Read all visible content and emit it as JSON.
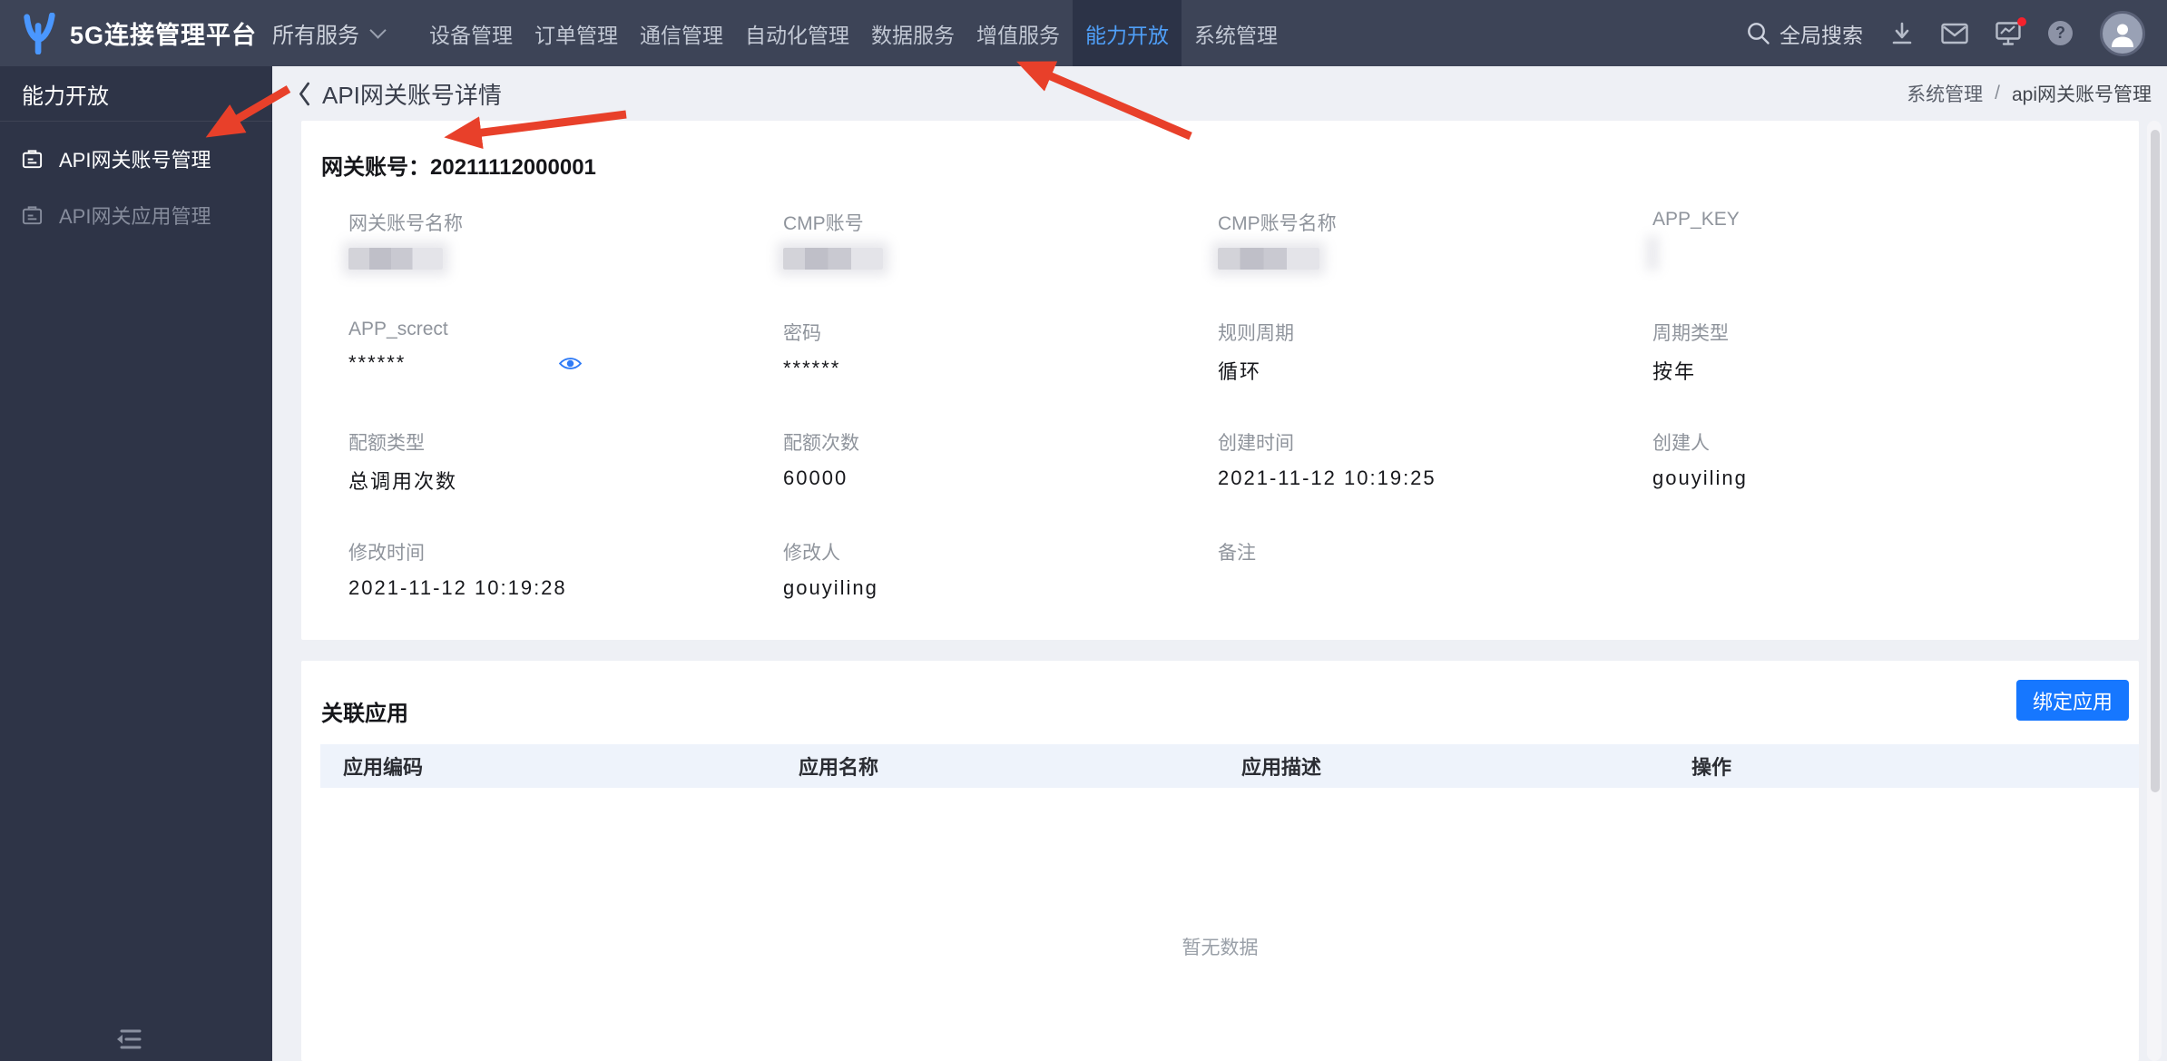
{
  "app": {
    "brand": "5G连接管理平台"
  },
  "topnav": {
    "all_services": "所有服务",
    "items": [
      {
        "label": "设备管理",
        "active": false
      },
      {
        "label": "订单管理",
        "active": false
      },
      {
        "label": "通信管理",
        "active": false
      },
      {
        "label": "自动化管理",
        "active": false
      },
      {
        "label": "数据服务",
        "active": false
      },
      {
        "label": "增值服务",
        "active": false
      },
      {
        "label": "能力开放",
        "active": true
      },
      {
        "label": "系统管理",
        "active": false
      }
    ],
    "search_label": "全局搜索",
    "help_glyph": "?"
  },
  "sidebar": {
    "section_title": "能力开放",
    "items": [
      {
        "label": "API网关账号管理",
        "active": true
      },
      {
        "label": "API网关应用管理",
        "active": false
      }
    ]
  },
  "page": {
    "title": "API网关账号详情",
    "breadcrumb": {
      "parent": "系统管理",
      "separator": "/",
      "current": "api网关账号管理"
    }
  },
  "detail": {
    "title_label": "网关账号：",
    "account_no": "20211112000001",
    "fields": [
      {
        "label": "网关账号名称",
        "value": "",
        "redacted": true
      },
      {
        "label": "CMP账号",
        "value": "",
        "redacted": true
      },
      {
        "label": "CMP账号名称",
        "value": "",
        "redacted": true
      },
      {
        "label": "APP_KEY",
        "value": "",
        "redacted": true
      },
      {
        "label": "APP_screct",
        "value": "******",
        "masked": true,
        "eye": true
      },
      {
        "label": "密码",
        "value": "******",
        "masked": true
      },
      {
        "label": "规则周期",
        "value": "循环"
      },
      {
        "label": "周期类型",
        "value": "按年"
      },
      {
        "label": "配额类型",
        "value": "总调用次数"
      },
      {
        "label": "配额次数",
        "value": "60000"
      },
      {
        "label": "创建时间",
        "value": "2021-11-12 10:19:25"
      },
      {
        "label": "创建人",
        "value": "gouyiling"
      },
      {
        "label": "修改时间",
        "value": "2021-11-12 10:19:28"
      },
      {
        "label": "修改人",
        "value": "gouyiling"
      },
      {
        "label": "备注",
        "value": ""
      }
    ]
  },
  "related": {
    "title": "关联应用",
    "bind_button": "绑定应用",
    "columns": [
      "应用编码",
      "应用名称",
      "应用描述",
      "操作"
    ],
    "rows": [],
    "empty_text": "暂无数据"
  },
  "colors": {
    "topbar": "#3d4457",
    "sidebar": "#2e3447",
    "active_nav_text": "#4f9ff8",
    "accent_button": "#1677ff",
    "page_background": "#eef0f5",
    "table_header_bg": "#eef3fb",
    "annotation_arrow": "#e8402a",
    "notification_dot": "#f5222d"
  }
}
